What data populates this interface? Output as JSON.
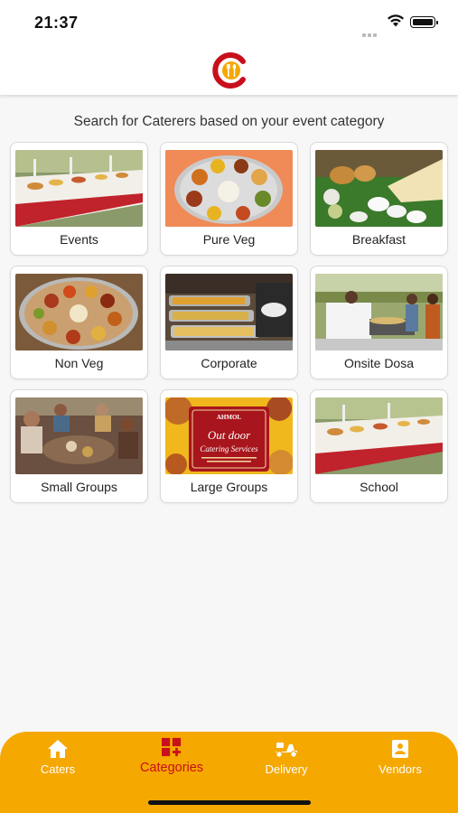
{
  "status_bar": {
    "time": "21:37"
  },
  "header": {
    "logo_icon": "caterer-logo-icon",
    "brand_color": "#c8101c",
    "accent_color": "#f5a800"
  },
  "subtitle": "Search for Caterers based on your event category",
  "categories": [
    {
      "label": "Events"
    },
    {
      "label": "Pure Veg"
    },
    {
      "label": "Breakfast"
    },
    {
      "label": "Non Veg"
    },
    {
      "label": "Corporate"
    },
    {
      "label": "Onsite Dosa"
    },
    {
      "label": "Small Groups"
    },
    {
      "label": "Large Groups",
      "banner_brand": "AHMOL",
      "banner_title_1": "Out door",
      "banner_title_2": "Catering Services"
    },
    {
      "label": "School"
    }
  ],
  "bottom_nav": {
    "items": [
      {
        "label": "Caters",
        "icon": "home-icon"
      },
      {
        "label": "Categories",
        "icon": "grid-plus-icon"
      },
      {
        "label": "Delivery",
        "icon": "scooter-icon"
      },
      {
        "label": "Vendors",
        "icon": "vendor-profile-icon"
      }
    ],
    "active": "Categories"
  }
}
